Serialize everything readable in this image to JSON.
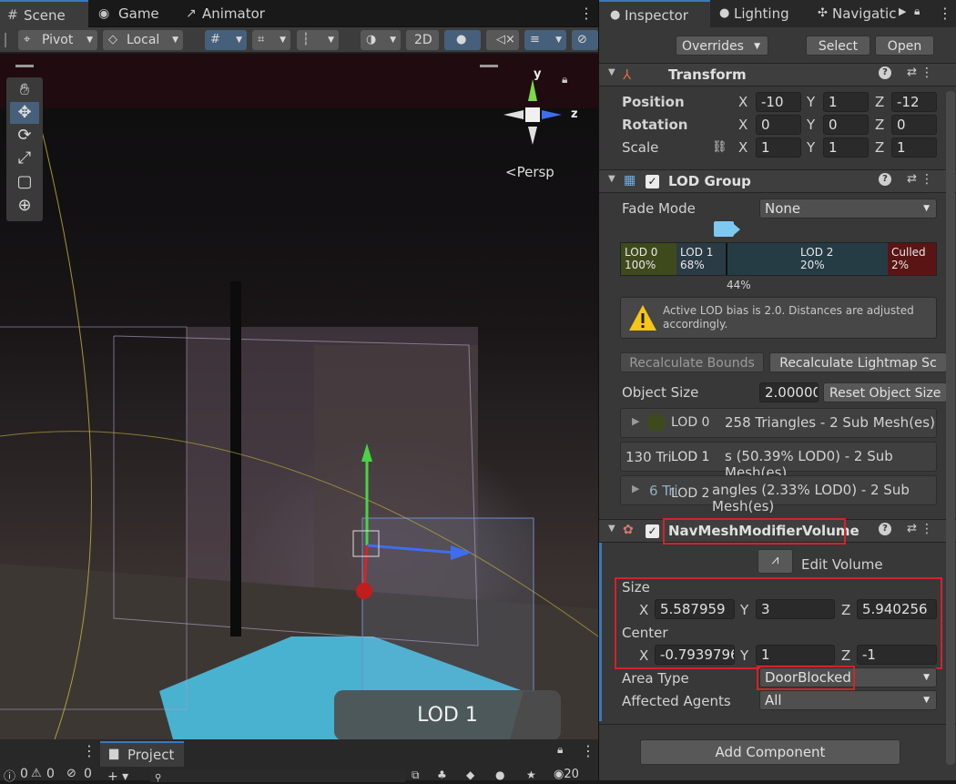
{
  "scene_tabs": {
    "scene": "Scene",
    "game": "Game",
    "animator": "Animator"
  },
  "toolbar": {
    "pivot": "Pivot",
    "local": "Local",
    "twod": "2D"
  },
  "viewport": {
    "gizmo_y": "y",
    "gizmo_z": "z",
    "persp": "Persp",
    "lod_label": "LOD 1"
  },
  "bottom": {
    "count_a": "0",
    "count_b": "0",
    "count_c": "0",
    "project": "Project",
    "search_placeholder": "",
    "hidden_count": "20"
  },
  "inspector_tabs": {
    "inspector": "Inspector",
    "lighting": "Lighting",
    "navigation": "Navigatic"
  },
  "prefab": {
    "overrides": "Overrides",
    "select": "Select",
    "open": "Open"
  },
  "transform": {
    "title": "Transform",
    "position_label": "Position",
    "rotation_label": "Rotation",
    "scale_label": "Scale",
    "position": {
      "x": "-10",
      "y": "1",
      "z": "-12"
    },
    "rotation": {
      "x": "0",
      "y": "0",
      "z": "0"
    },
    "scale": {
      "x": "1",
      "y": "1",
      "z": "1"
    }
  },
  "axis": {
    "x": "X",
    "y": "Y",
    "z": "Z"
  },
  "lod_group": {
    "title": "LOD Group",
    "fade_mode_label": "Fade Mode",
    "fade_mode": "None",
    "segments": [
      {
        "name": "LOD 0",
        "pct": "100%"
      },
      {
        "name": "LOD 1",
        "pct": "68%"
      },
      {
        "name": "LOD 2",
        "pct": "20%"
      },
      {
        "name": "Culled",
        "pct": "2%"
      }
    ],
    "marker": "44%",
    "warning": "Active LOD bias is 2.0. Distances are adjusted accordingly.",
    "recalc_bounds": "Recalculate Bounds",
    "recalc_lightmap": "Recalculate Lightmap Sc",
    "object_size_label": "Object Size",
    "object_size": "2.00000",
    "reset_size": "Reset Object Size",
    "rows": [
      {
        "name": "LOD 0",
        "info": "258 Triangles  - 2 Sub Mesh(es)"
      },
      {
        "name": "LOD 1",
        "prefix": "130 Tri",
        "info": "s (50.39% LOD0) - 2 Sub Mesh(es)"
      },
      {
        "name": "LOD 2",
        "prefix": "6 Tri",
        "info": "angles (2.33% LOD0) - 2 Sub Mesh(es)"
      }
    ]
  },
  "navmesh": {
    "title": "NavMeshModifierVolume",
    "edit_volume": "Edit Volume",
    "size_label": "Size",
    "center_label": "Center",
    "size": {
      "x": "5.587959",
      "y": "3",
      "z": "5.940256"
    },
    "center": {
      "x": "-0.7939796",
      "y": "1",
      "z": "-1"
    },
    "area_type_label": "Area Type",
    "area_type": "DoorBlocked",
    "affected_agents_label": "Affected Agents",
    "affected_agents": "All"
  },
  "add_component": "Add Component",
  "colors": {
    "accent": "#3a79bb",
    "highlight": "#d2232a",
    "lod0": "#3f4a1c",
    "lod1": "#2b3b45",
    "lod2": "#263c45",
    "culled": "#5a1414"
  }
}
